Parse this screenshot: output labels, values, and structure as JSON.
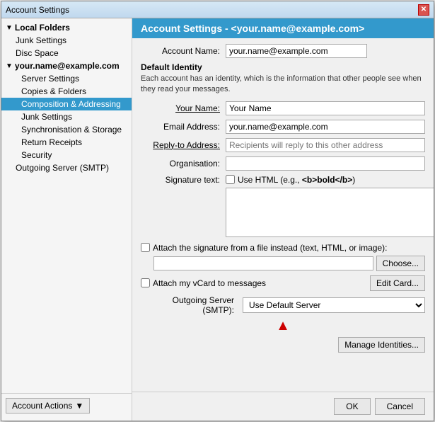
{
  "dialog": {
    "title": "Account Settings",
    "close_label": "✕"
  },
  "left_panel": {
    "local_folders_label": "Local Folders",
    "junk_settings_label": "Junk Settings",
    "disc_space_label": "Disc Space",
    "account_label": "your.name@example.com",
    "server_settings_label": "Server Settings",
    "copies_folders_label": "Copies & Folders",
    "composition_label": "Composition & Addressing",
    "junk_settings2_label": "Junk Settings",
    "synchronisation_label": "Synchronisation & Storage",
    "return_receipts_label": "Return Receipts",
    "security_label": "Security",
    "outgoing_server_label": "Outgoing Server (SMTP)"
  },
  "account_actions": {
    "label": "Account Actions",
    "arrow": "▼"
  },
  "right_panel": {
    "header": "Account Settings - <your.name@example.com>",
    "account_name_label": "Account Name:",
    "account_name_value": "your.name@example.com",
    "default_identity_title": "Default Identity",
    "default_identity_desc": "Each account has an identity, which is the information that other people see when they read your messages.",
    "your_name_label": "Your Name:",
    "your_name_value": "Your Name",
    "email_label": "Email Address:",
    "email_value": "your.name@example.com",
    "reply_to_label": "Reply-to Address:",
    "reply_to_placeholder": "Recipients will reply to this other address",
    "organisation_label": "Organisation:",
    "organisation_value": "",
    "signature_text_label": "Signature text:",
    "use_html_label": "Use HTML (e.g., ",
    "bold_example": "<b>bold</b>",
    "use_html_end": ")",
    "attach_sig_label": "Attach the signature from a file instead (text, HTML, or image):",
    "choose_label": "Choose...",
    "edit_card_label": "Edit Card...",
    "attach_vcard_label": "Attach my vCard to messages",
    "outgoing_server_label": "Outgoing Server (SMTP):",
    "outgoing_server_value": "Use Default Server",
    "manage_identities_label": "Manage Identities...",
    "ok_label": "OK",
    "cancel_label": "Cancel"
  }
}
